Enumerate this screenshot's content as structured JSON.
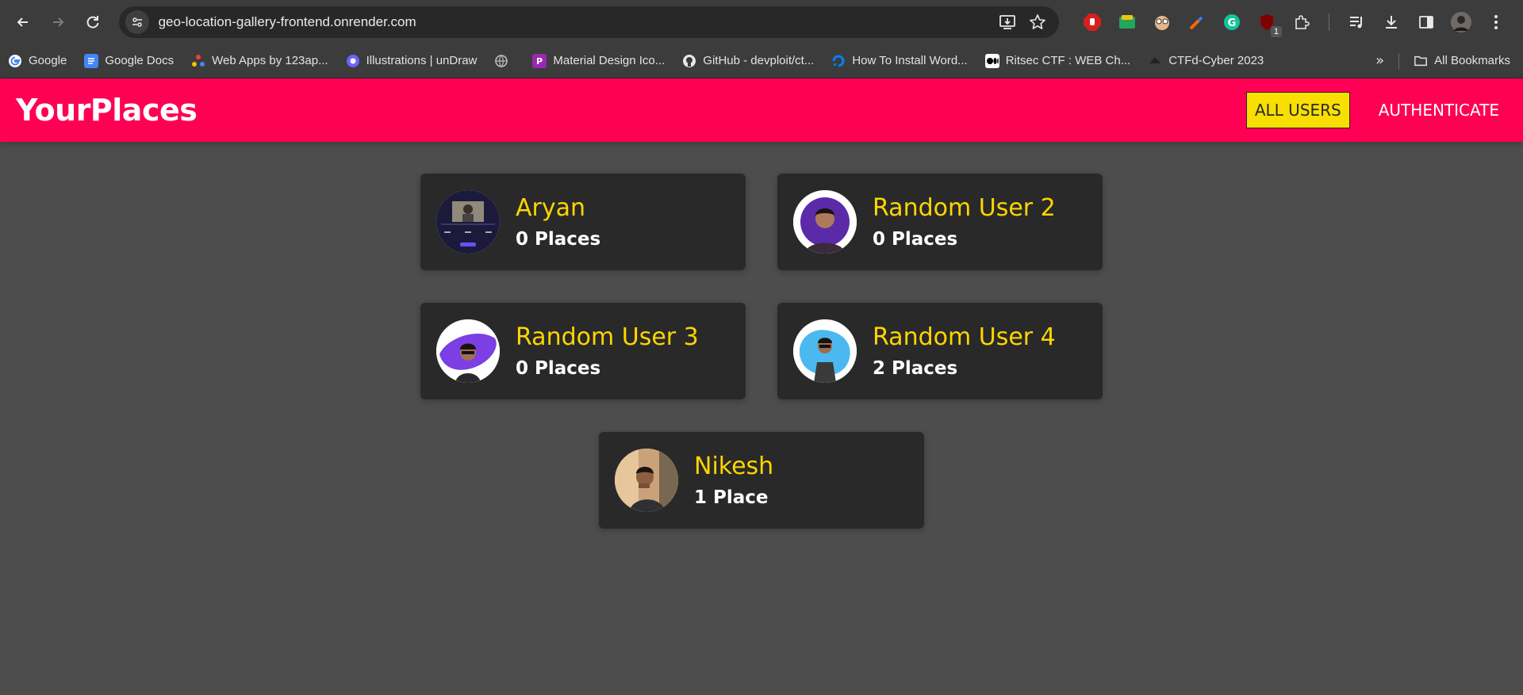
{
  "browser": {
    "url": "geo-location-gallery-frontend.onrender.com",
    "bookmarks": [
      {
        "label": "Google",
        "icon": "google-icon"
      },
      {
        "label": "Google Docs",
        "icon": "docs-icon"
      },
      {
        "label": "Web Apps by 123ap...",
        "icon": "webapps-icon"
      },
      {
        "label": "Illustrations | unDraw",
        "icon": "undraw-icon"
      },
      {
        "label": "",
        "icon": "globe-icon"
      },
      {
        "label": "Material Design Ico...",
        "icon": "material-icon"
      },
      {
        "label": "GitHub - devploit/ct...",
        "icon": "github-icon"
      },
      {
        "label": "How To Install Word...",
        "icon": "digitalocean-icon"
      },
      {
        "label": "Ritsec CTF : WEB Ch...",
        "icon": "medium-icon"
      },
      {
        "label": "CTFd-Cyber 2023",
        "icon": "ctfd-icon"
      }
    ],
    "all_bookmarks_label": "All Bookmarks",
    "extension_badge": "1"
  },
  "app": {
    "brand": "YourPlaces",
    "nav": {
      "all_users": "ALL USERS",
      "authenticate": "AUTHENTICATE"
    }
  },
  "users": [
    {
      "name": "Aryan",
      "places": "0 Places"
    },
    {
      "name": "Random User 2",
      "places": "0 Places"
    },
    {
      "name": "Random User 3",
      "places": "0 Places"
    },
    {
      "name": "Random User 4",
      "places": "2 Places"
    },
    {
      "name": "Nikesh",
      "places": "1 Place"
    }
  ],
  "colors": {
    "header": "#ff0055",
    "accent": "#ffd500",
    "card": "#292929",
    "page": "#4d4d4d"
  }
}
